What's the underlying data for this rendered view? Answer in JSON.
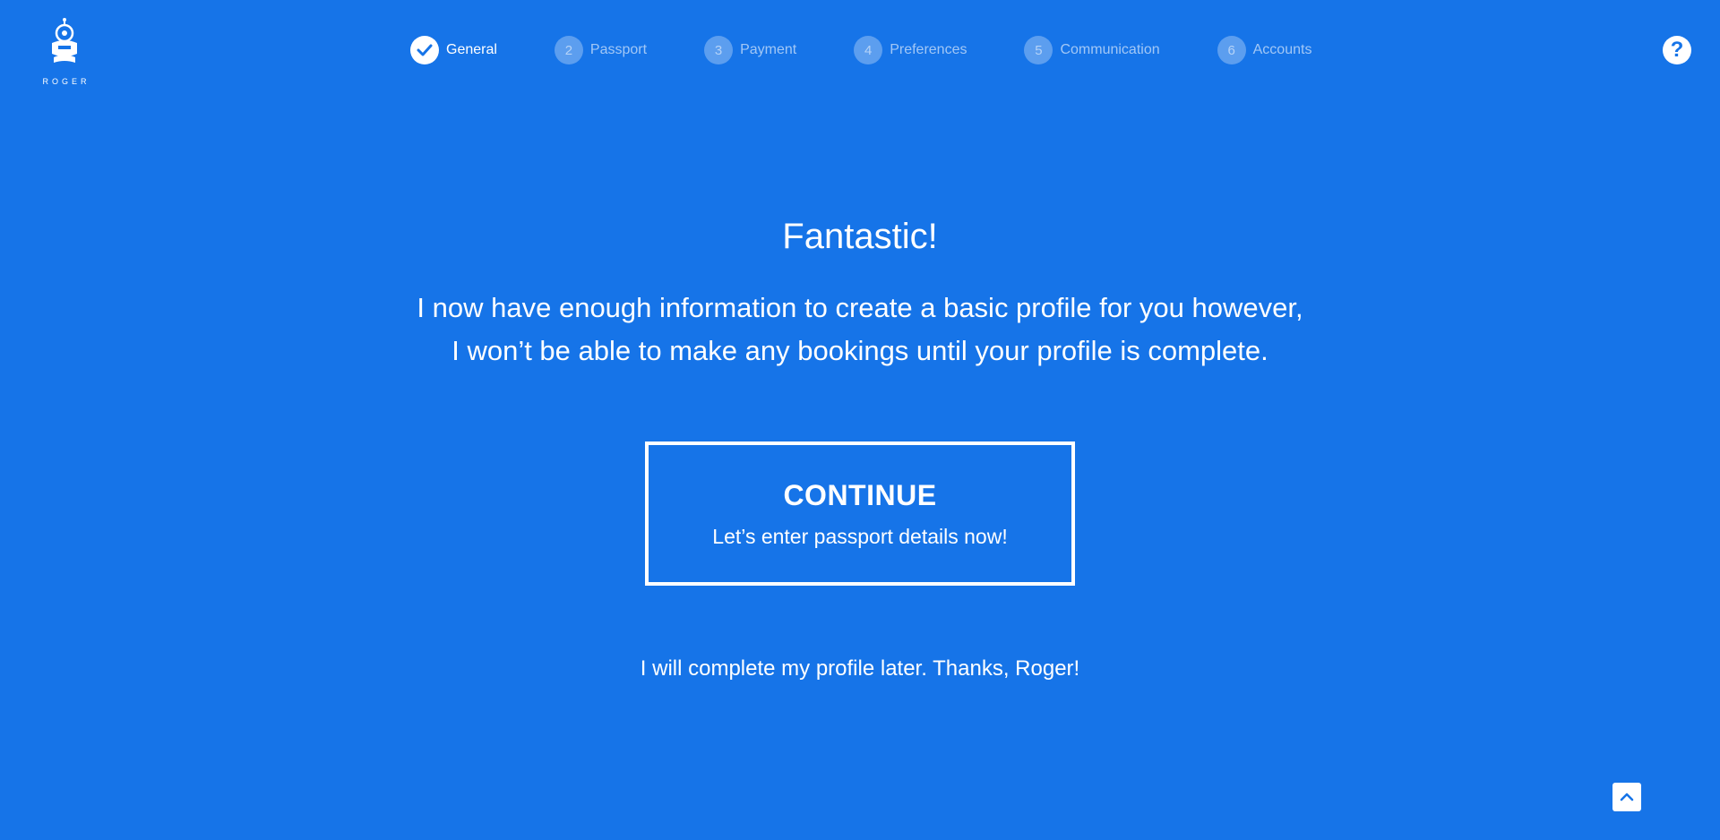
{
  "logo": {
    "text": "ROGER",
    "icon": "robot-icon"
  },
  "stepper": {
    "steps": [
      {
        "number": "",
        "label": "General",
        "state": "completed",
        "icon": "check-icon"
      },
      {
        "number": "2",
        "label": "Passport",
        "state": "pending"
      },
      {
        "number": "3",
        "label": "Payment",
        "state": "pending"
      },
      {
        "number": "4",
        "label": "Preferences",
        "state": "pending"
      },
      {
        "number": "5",
        "label": "Communication",
        "state": "pending"
      },
      {
        "number": "6",
        "label": "Accounts",
        "state": "pending"
      }
    ]
  },
  "help": {
    "label": "?",
    "icon": "help-icon"
  },
  "main": {
    "heading": "Fantastic!",
    "message_line1": "I now have enough information to create a basic profile for you however,",
    "message_line2": "I won’t be able to make any bookings until your profile is complete.",
    "continue_title": "CONTINUE",
    "continue_subtitle": "Let’s enter passport details now!",
    "later_link": "I will complete my profile later. Thanks, Roger!"
  },
  "scroll_top": {
    "icon": "chevron-up-icon"
  },
  "colors": {
    "background": "#1674e8",
    "foreground": "#ffffff"
  }
}
